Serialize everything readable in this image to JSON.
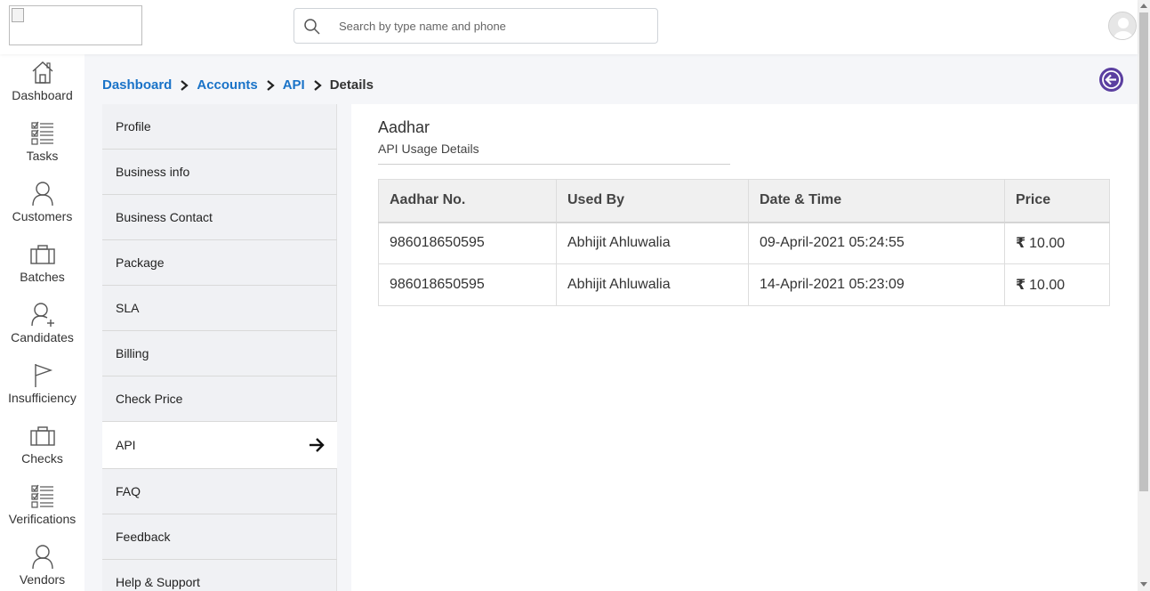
{
  "header": {
    "search_placeholder": "Search by type name and phone"
  },
  "leftnav": {
    "items": [
      {
        "label": "Dashboard",
        "icon": "home-icon"
      },
      {
        "label": "Tasks",
        "icon": "checklist-icon"
      },
      {
        "label": "Customers",
        "icon": "user-icon"
      },
      {
        "label": "Batches",
        "icon": "briefcase-icon"
      },
      {
        "label": "Candidates",
        "icon": "user-add-icon"
      },
      {
        "label": "Insufficiency",
        "icon": "flag-icon"
      },
      {
        "label": "Checks",
        "icon": "briefcase-icon"
      },
      {
        "label": "Verifications",
        "icon": "checklist-icon"
      },
      {
        "label": "Vendors",
        "icon": "user-icon"
      }
    ]
  },
  "breadcrumb": {
    "items": [
      "Dashboard",
      "Accounts",
      "API"
    ],
    "current": "Details"
  },
  "submenu": {
    "items": [
      "Profile",
      "Business info",
      "Business Contact",
      "Package",
      "SLA",
      "Billing",
      "Check Price",
      "API",
      "FAQ",
      "Feedback",
      "Help & Support"
    ],
    "active": "API"
  },
  "panel": {
    "title": "Aadhar",
    "subtitle": "API Usage Details",
    "table": {
      "headers": [
        "Aadhar No.",
        "Used By",
        "Date & Time",
        "Price"
      ],
      "rows": [
        [
          "986018650595",
          "Abhijit Ahluwalia",
          "09-April-2021 05:24:55",
          "10.00"
        ],
        [
          "986018650595",
          "Abhijit Ahluwalia",
          "14-April-2021 05:23:09",
          "10.00"
        ]
      ],
      "currency_symbol": "₹"
    }
  },
  "colors": {
    "link": "#1a73c8",
    "back_button": "#5b3fa0"
  }
}
